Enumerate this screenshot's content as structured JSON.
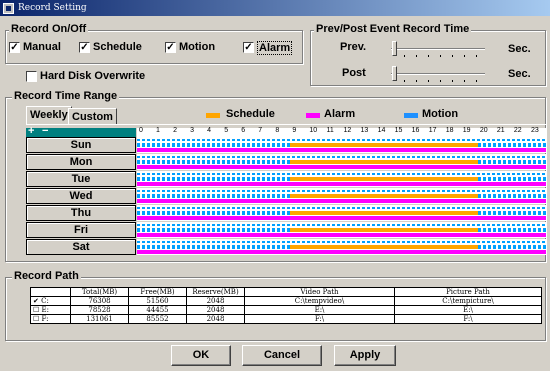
{
  "window": {
    "title": "Record Setting"
  },
  "record_onoff": {
    "label": "Record On/Off",
    "items": [
      {
        "label": "Manual",
        "checked": true
      },
      {
        "label": "Schedule",
        "checked": true
      },
      {
        "label": "Motion",
        "checked": true
      },
      {
        "label": "Alarm",
        "checked": true
      }
    ]
  },
  "hard_disk": {
    "label": "Hard Disk Overwrite",
    "checked": false
  },
  "prepost": {
    "label": "Prev/Post Event Record Time",
    "prev_label": "Prev.",
    "post_label": "Post",
    "unit": "Sec.",
    "prev_value": 0,
    "post_value": 0
  },
  "time_range": {
    "label": "Record Time Range",
    "tabs": [
      "Weekly",
      "Custom"
    ],
    "legend": [
      {
        "label": "Schedule",
        "color": "#ffa500"
      },
      {
        "label": "Alarm",
        "color": "#ff00ff"
      },
      {
        "label": "Motion",
        "color": "#1e90ff"
      }
    ],
    "plus": "+",
    "minus": "−",
    "hours": [
      "0",
      "1",
      "2",
      "3",
      "4",
      "5",
      "6",
      "7",
      "8",
      "9",
      "10",
      "11",
      "12",
      "13",
      "14",
      "15",
      "16",
      "17",
      "18",
      "19",
      "20",
      "21",
      "22",
      "23"
    ],
    "days": [
      "Sun",
      "Mon",
      "Tue",
      "Wed",
      "Thu",
      "Fri",
      "Sat"
    ],
    "schedule_hours": [
      9,
      20
    ]
  },
  "record_path": {
    "label": "Record Path",
    "headers": [
      "",
      "Total(MB)",
      "Free(MB)",
      "Reserve(MB)",
      "Video Path",
      "Picture Path"
    ],
    "rows": [
      {
        "checked": true,
        "drive": "C:",
        "total": "76308",
        "free": "51560",
        "reserve": "2048",
        "video": "C:\\tempvideo\\",
        "picture": "C:\\tempicture\\"
      },
      {
        "checked": false,
        "drive": "E:",
        "total": "78528",
        "free": "44455",
        "reserve": "2048",
        "video": "E:\\",
        "picture": "E:\\"
      },
      {
        "checked": false,
        "drive": "F:",
        "total": "131061",
        "free": "85552",
        "reserve": "2048",
        "video": "F:\\",
        "picture": "F:\\"
      }
    ]
  },
  "buttons": {
    "ok": "OK",
    "cancel": "Cancel",
    "apply": "Apply"
  },
  "check_mark": "✔"
}
